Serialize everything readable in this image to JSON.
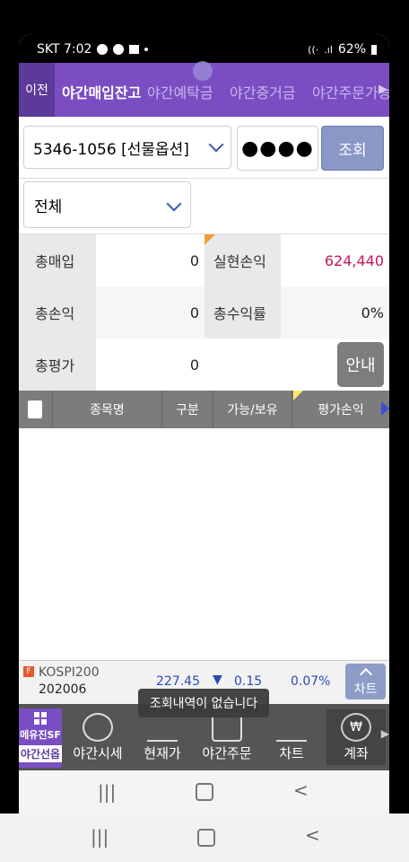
{
  "status_bar": {
    "carrier_time": "SKT 7:02",
    "battery": "62%"
  },
  "tabbar": {
    "prev_label": "이전",
    "tabs": [
      {
        "label": "야간매입잔고",
        "active": true
      },
      {
        "label": "야간예탁금",
        "active": false
      },
      {
        "label": "야간증거금",
        "active": false
      },
      {
        "label": "야간주문가능",
        "active": false
      }
    ]
  },
  "account": {
    "value": "5346-1056 [선물옵션]",
    "password_mask": "●●●●",
    "query_button": "조회"
  },
  "filter": {
    "selected": "전체"
  },
  "summary": {
    "total_buy_label": "총매입",
    "total_buy": "0",
    "realized_pl_label": "실현손익",
    "realized_pl": "624,440",
    "total_pl_label": "총손익",
    "total_pl": "0",
    "total_return_label": "총수익률",
    "total_return": "0%",
    "total_eval_label": "총평가",
    "total_eval": "0",
    "guide_button": "안내"
  },
  "table": {
    "headers": [
      "종목명",
      "구분",
      "가능/보유",
      "평가손익"
    ]
  },
  "ticker": {
    "badge": "F",
    "name": "KOSPI200",
    "code": "202006",
    "price": "227.45",
    "change_arrow": "▼",
    "change": "0.15",
    "percent": "0.07%",
    "chart_button": "차트"
  },
  "toast": "조회내역이 없습니다",
  "bottom_nav": {
    "app_line1": "메유진SF",
    "app_line2": "야간선옵",
    "items": [
      {
        "label": "야간시세"
      },
      {
        "label": "현재가"
      },
      {
        "label": "야간주문"
      },
      {
        "label": "차트"
      },
      {
        "label": "계좌"
      }
    ]
  },
  "colors": {
    "purple": "#7a4ec2",
    "profit": "#c2185b",
    "price_blue": "#2c4bb5"
  }
}
